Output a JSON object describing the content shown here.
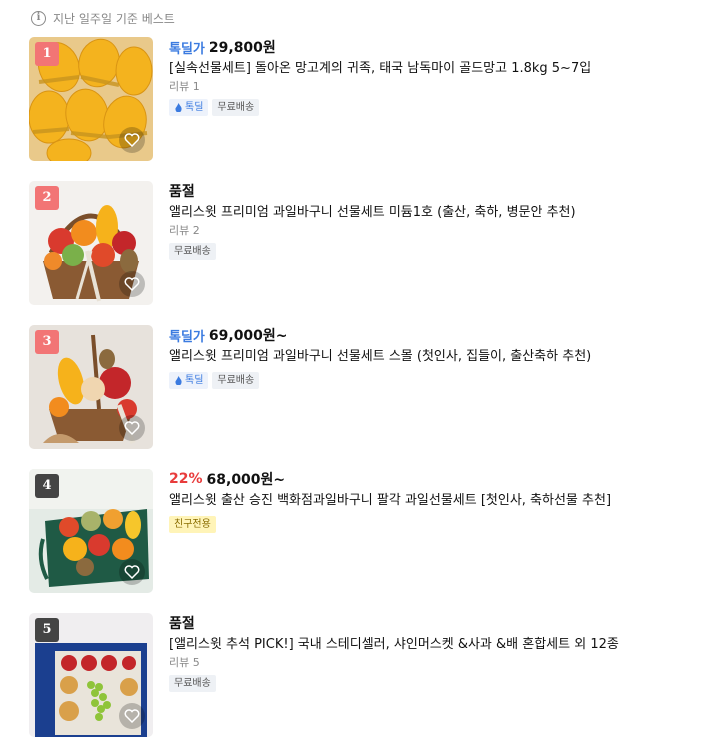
{
  "header": {
    "text": "지난 일주일 기준 베스트"
  },
  "items": [
    {
      "rank": "1",
      "deal_label": "톡딜가",
      "discount": "",
      "price": "29,800원",
      "title": "[실속선물세트] 돌아온 망고계의 귀족, 태국 남독마이 골드망고 1.8kg 5~7입",
      "review": "리뷰 1",
      "badges": [
        "톡딜",
        "무료배송"
      ]
    },
    {
      "rank": "2",
      "deal_label": "",
      "discount": "",
      "price": "품절",
      "title": "앨리스윗 프리미엄 과일바구니 선물세트 미듐1호 (출산, 축하, 병문안 추천)",
      "review": "리뷰 2",
      "badges": [
        "무료배송"
      ]
    },
    {
      "rank": "3",
      "deal_label": "톡딜가",
      "discount": "",
      "price": "69,000원~",
      "title": "앨리스윗 프리미엄 과일바구니 선물세트 스몰 (첫인사, 집들이, 출산축하 추천)",
      "review": "",
      "badges": [
        "톡딜",
        "무료배송"
      ]
    },
    {
      "rank": "4",
      "deal_label": "",
      "discount": "22%",
      "price": "68,000원~",
      "title": "앨리스윗 출산 승진 백화점과일바구니 팔각 과일선물세트 [첫인사, 축하선물 추천]",
      "review": "",
      "badges": [
        "친구전용"
      ]
    },
    {
      "rank": "5",
      "deal_label": "",
      "discount": "",
      "price": "품절",
      "title": "[앨리스윗 추석 PICK!] 국내 스테디셀러, 샤인머스켓 &사과 &배 혼합세트 외 12종",
      "review": "리뷰 5",
      "badges": [
        "무료배송"
      ]
    }
  ],
  "colors": {
    "deal": "#3b7be0",
    "discount": "#e83c3c",
    "rank_top": "#f27575",
    "rank_other": "#444444"
  },
  "icons": {
    "info": "info-circle-icon",
    "heart": "heart-outline-icon",
    "talkdeal": "talkdeal-icon"
  }
}
